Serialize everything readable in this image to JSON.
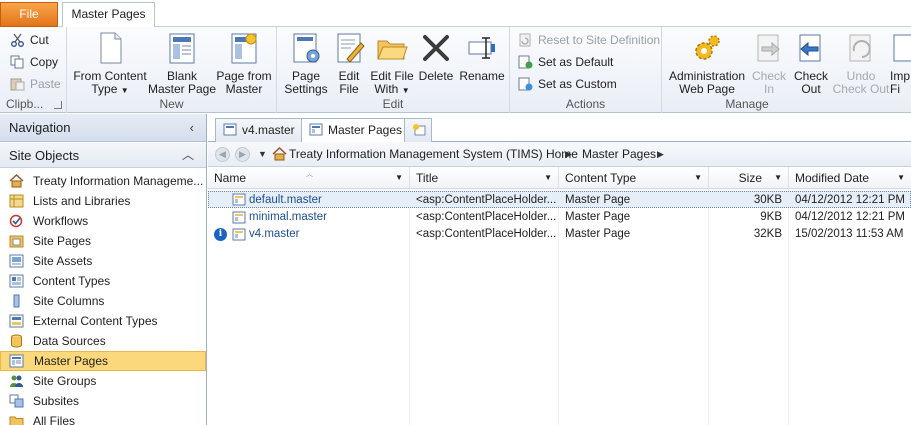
{
  "ribbon": {
    "file_tab": "File",
    "active_tab": "Master Pages",
    "clipboard": {
      "cut": "Cut",
      "copy": "Copy",
      "paste": "Paste",
      "label": "Clipb..."
    },
    "new": {
      "from_content_type": [
        "From Content",
        "Type"
      ],
      "blank_master_page": [
        "Blank",
        "Master Page"
      ],
      "page_from_master": [
        "Page from",
        "Master"
      ],
      "label": "New"
    },
    "edit": {
      "page_settings": [
        "Page",
        "Settings"
      ],
      "edit_file": [
        "Edit",
        "File"
      ],
      "edit_file_with": [
        "Edit File",
        "With"
      ],
      "delete": "Delete",
      "rename": "Rename",
      "label": "Edit"
    },
    "actions": {
      "reset": "Reset to Site Definition",
      "set_default": "Set as Default",
      "set_custom": "Set as Custom",
      "label": "Actions"
    },
    "manage": {
      "admin_web_page": [
        "Administration",
        "Web Page"
      ],
      "check_in": [
        "Check",
        "In"
      ],
      "check_out": [
        "Check",
        "Out"
      ],
      "undo_check_out": [
        "Undo",
        "Check Out"
      ],
      "import_files": [
        "Imp",
        "Fi"
      ],
      "label": "Manage"
    }
  },
  "navigation": {
    "title": "Navigation",
    "section": "Site Objects",
    "items": [
      {
        "label": "Treaty Information Manageme...",
        "icon": "home-icon"
      },
      {
        "label": "Lists and Libraries",
        "icon": "list-icon"
      },
      {
        "label": "Workflows",
        "icon": "workflow-icon"
      },
      {
        "label": "Site Pages",
        "icon": "site-pages-icon"
      },
      {
        "label": "Site Assets",
        "icon": "site-assets-icon"
      },
      {
        "label": "Content Types",
        "icon": "content-types-icon"
      },
      {
        "label": "Site Columns",
        "icon": "site-columns-icon"
      },
      {
        "label": "External Content Types",
        "icon": "external-content-types-icon"
      },
      {
        "label": "Data Sources",
        "icon": "data-sources-icon"
      },
      {
        "label": "Master Pages",
        "icon": "master-pages-icon"
      },
      {
        "label": "Site Groups",
        "icon": "site-groups-icon"
      },
      {
        "label": "Subsites",
        "icon": "subsites-icon"
      },
      {
        "label": "All Files",
        "icon": "folder-icon"
      }
    ]
  },
  "doc_tabs": [
    "v4.master",
    "Master Pages"
  ],
  "breadcrumb": {
    "site": "Treaty Information Management System (TIMS) Home",
    "current": "Master Pages"
  },
  "table": {
    "columns": [
      "Name",
      "Title",
      "Content Type",
      "Size",
      "Modified Date"
    ],
    "rows": [
      {
        "name": "default.master",
        "title": "<asp:ContentPlaceHolder...",
        "content_type": "Master Page",
        "size": "30KB",
        "modified": "04/12/2012 12:21 PM"
      },
      {
        "name": "minimal.master",
        "title": "<asp:ContentPlaceHolder...",
        "content_type": "Master Page",
        "size": "9KB",
        "modified": "04/12/2012 12:21 PM"
      },
      {
        "name": "v4.master",
        "title": "<asp:ContentPlaceHolder...",
        "content_type": "Master Page",
        "size": "32KB",
        "modified": "15/02/2013 11:53 AM"
      }
    ]
  },
  "colors": {
    "file_tab": "#e3751c",
    "selection": "#fbd87b",
    "link": "#1b4f93"
  }
}
